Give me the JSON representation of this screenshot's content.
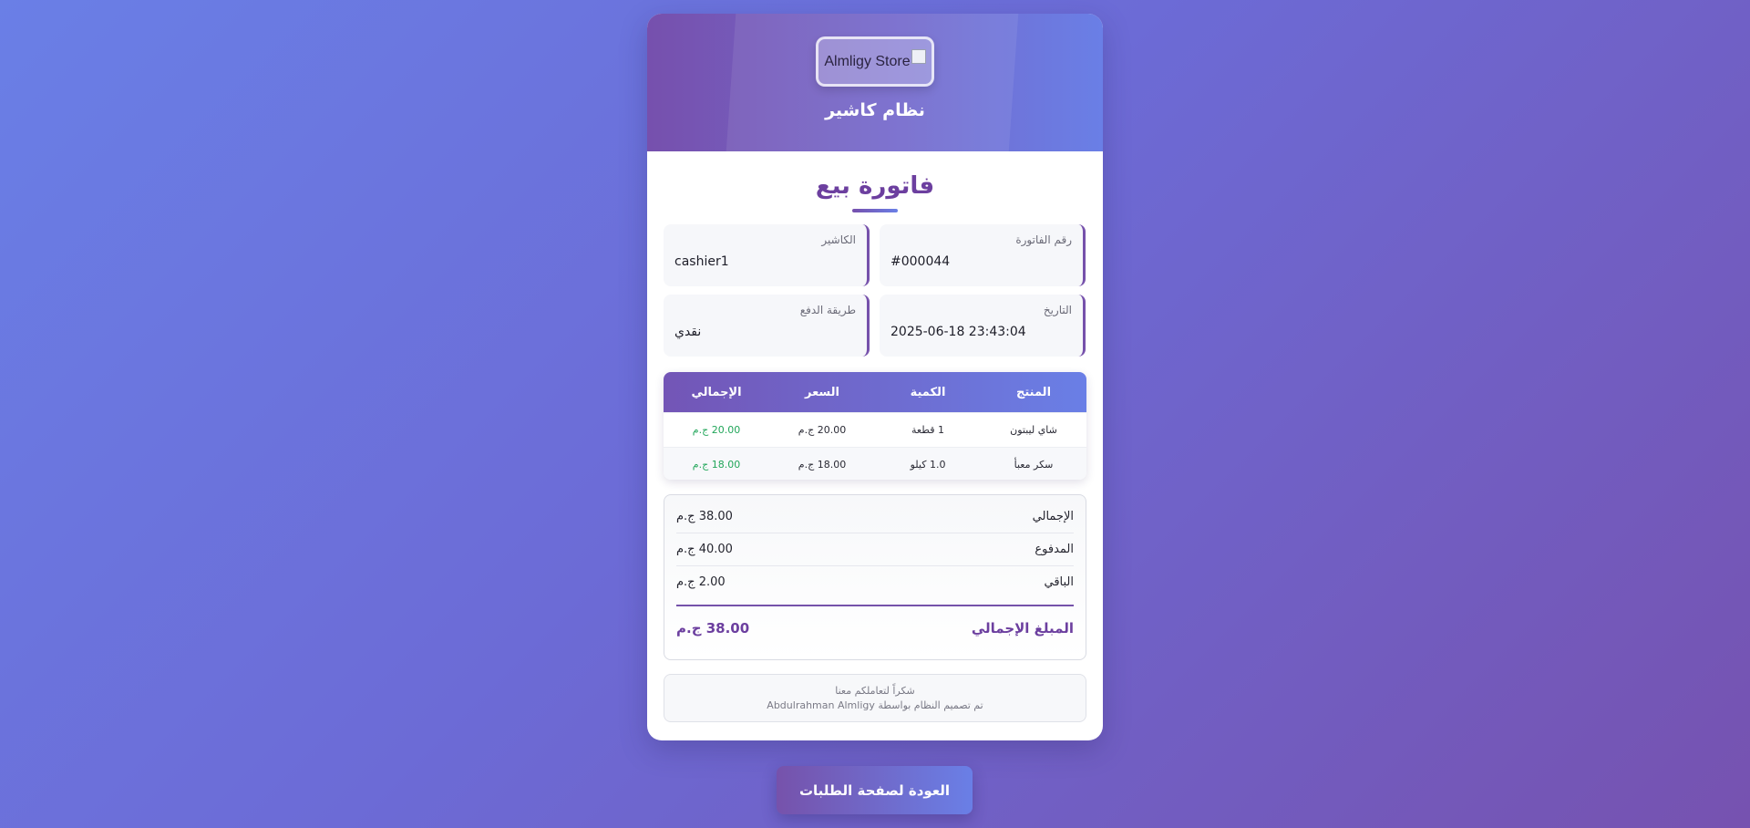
{
  "header": {
    "logo_alt": "Almligy Store",
    "system_title": "نظام كاشير"
  },
  "invoice": {
    "title": "فاتورة بيع",
    "info": {
      "invoice_no_label": "رقم الفاتورة",
      "invoice_no": "#000044",
      "cashier_label": "الكاشير",
      "cashier": "cashier1",
      "date_label": "التاريخ",
      "date": "2025-06-18 23:43:04",
      "payment_label": "طريقة الدفع",
      "payment": "نقدي"
    },
    "table": {
      "headers": [
        "المنتج",
        "الكمية",
        "السعر",
        "الإجمالي"
      ],
      "rows": [
        {
          "product": "شاي ليبتون",
          "qty": "1 قطعة",
          "price": "20.00 ج.م",
          "total": "20.00 ج.م"
        },
        {
          "product": "سكر معبأ",
          "qty": "1.0 كيلو",
          "price": "18.00 ج.م",
          "total": "18.00 ج.م"
        }
      ]
    },
    "summary": {
      "subtotal_label": "الإجمالي",
      "subtotal": "38.00 ج.م",
      "paid_label": "المدفوع",
      "paid": "40.00 ج.م",
      "change_label": "الباقي",
      "change": "2.00 ج.م",
      "grand_label": "المبلغ الإجمالي",
      "grand": "38.00 ج.م"
    },
    "footer": {
      "thanks": "شكراً لتعاملكم معنا",
      "credit": "تم تصميم النظام بواسطة Abdulrahman Almligy"
    }
  },
  "actions": {
    "back_label": "العودة لصفحة الطلبات"
  },
  "colors": {
    "accent_purple": "#6c3f9f",
    "accent_blue": "#6a7fe6",
    "total_green": "#22a65a"
  }
}
